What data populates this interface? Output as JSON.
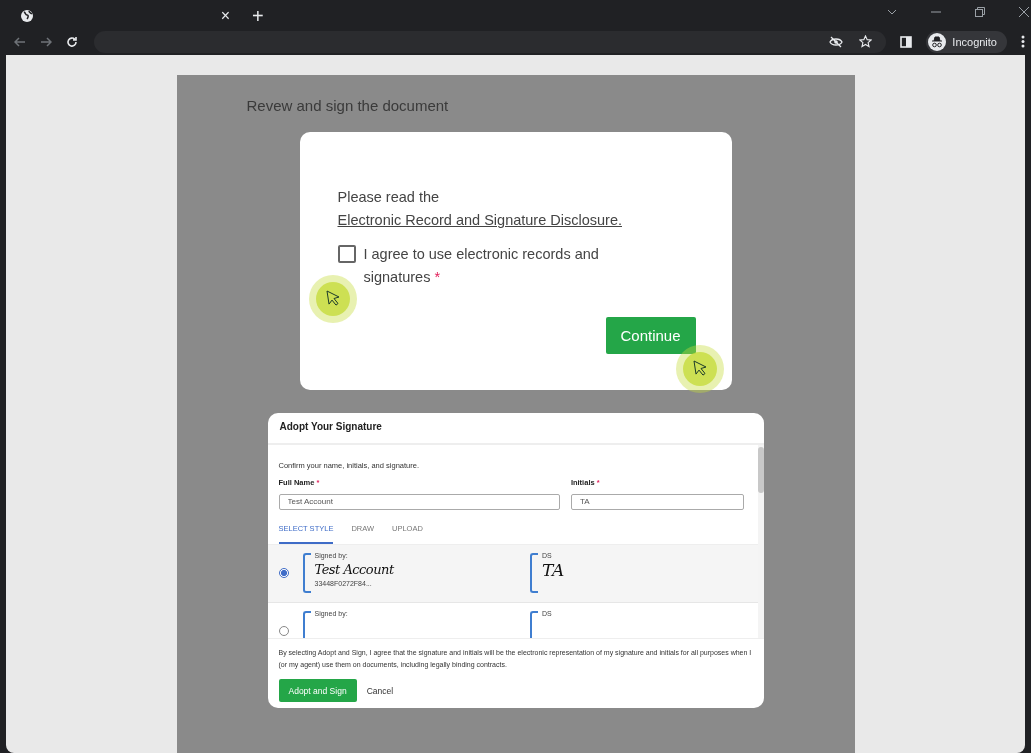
{
  "browser": {
    "tab_close": "×",
    "new_tab": "+",
    "profile": "Incognito"
  },
  "page": {
    "heading": "Revew and sign the document"
  },
  "consent": {
    "intro": "Please read the ",
    "link": "Electronic Record and Signature Disclosure.",
    "agree": {
      "label": "I agree to use electronic records and signatures",
      "required": "*",
      "checked": false
    },
    "button": "Continue"
  },
  "adopt": {
    "title": "Adopt Your Signature",
    "instruction": "Confirm your name, initials, and signature.",
    "fields": [
      {
        "label": "Full Name",
        "required": "*",
        "value": "Test Account"
      },
      {
        "label": "Initials",
        "required": "*",
        "value": "TA"
      }
    ],
    "tabs": [
      {
        "label": "SELECT STYLE",
        "selected": true
      },
      {
        "label": "DRAW",
        "selected": false
      },
      {
        "label": "UPLOAD",
        "selected": false
      }
    ],
    "options": [
      {
        "selected": true,
        "signed_by": "Signed by:",
        "signature": "Test Account",
        "code": "33448F0272F84...",
        "initials_label": "DS",
        "initials": "TA"
      },
      {
        "selected": false,
        "signed_by": "Signed by:",
        "initials_label": "DS"
      }
    ],
    "legal": "By selecting Adopt and Sign, I agree that the signature and initials will be the electronic representation of my signature and initials for all purposes when I (or my agent) use them on documents, including legally binding contracts.",
    "buttons": [
      {
        "label": "Adopt and Sign",
        "kind": "primary"
      },
      {
        "label": "Cancel",
        "kind": "plain"
      }
    ]
  }
}
